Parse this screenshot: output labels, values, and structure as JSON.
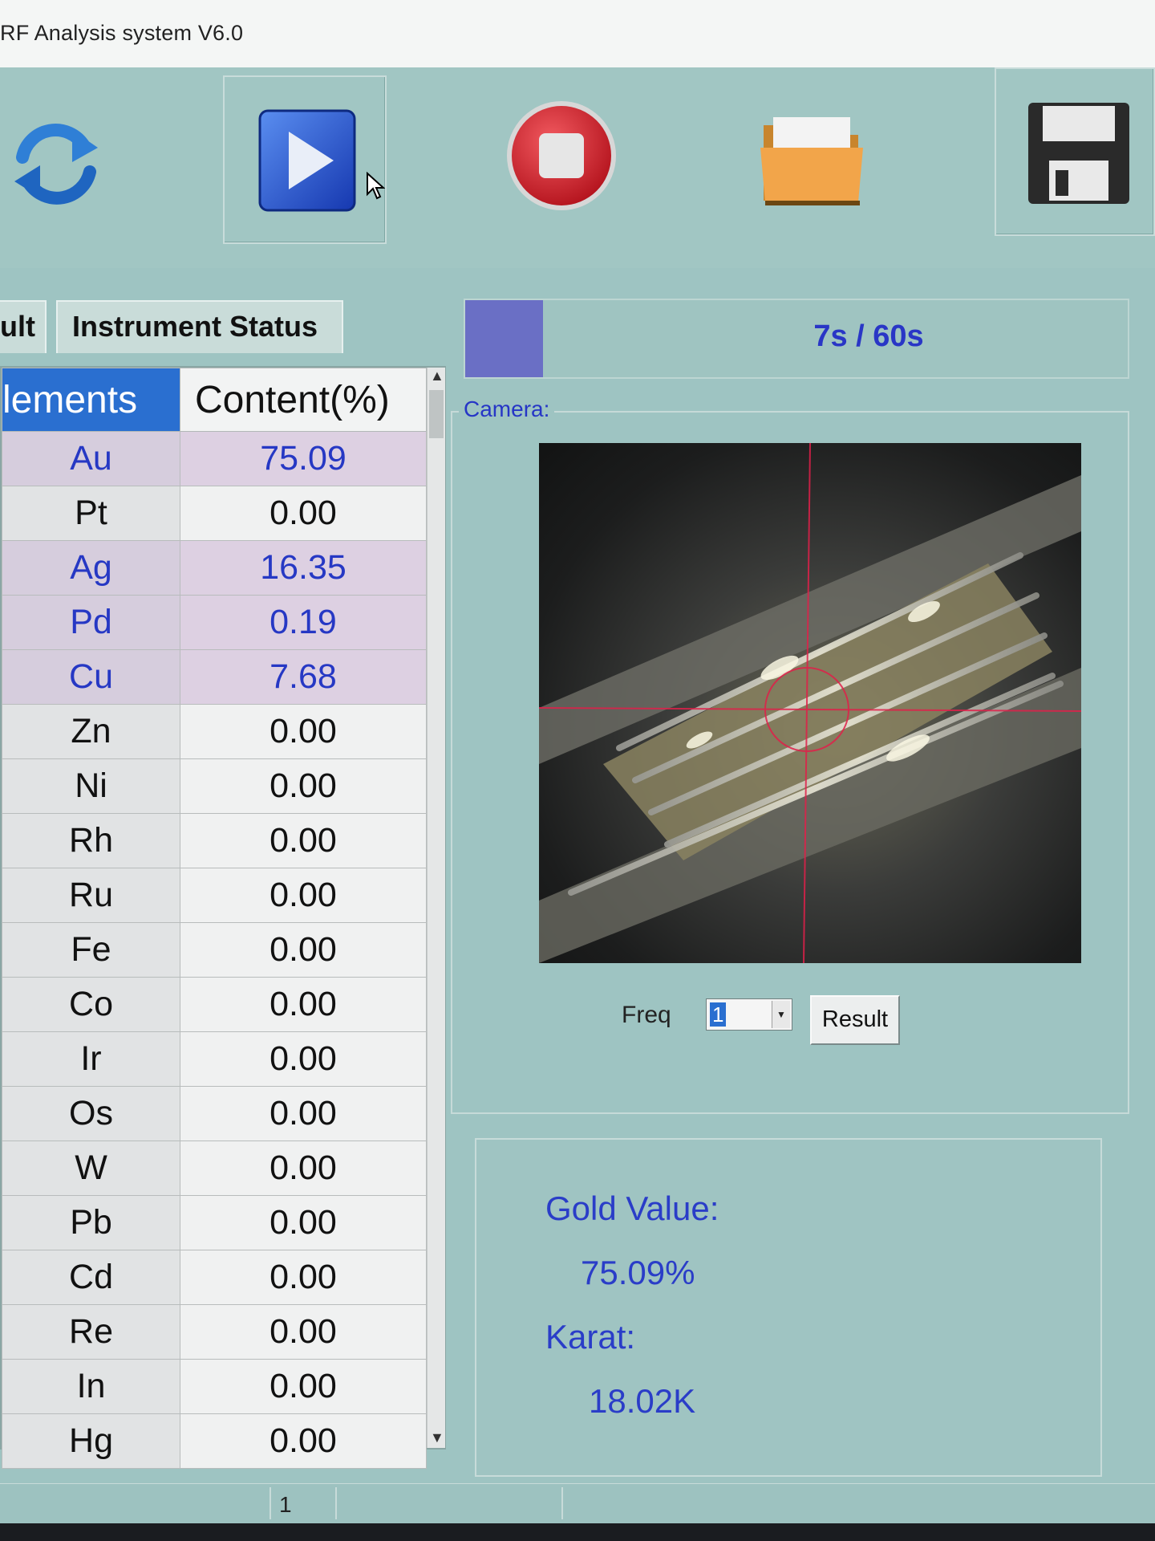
{
  "window": {
    "title": "RF Analysis system V6.0"
  },
  "toolbar": {
    "buttons": [
      {
        "name": "refresh-icon"
      },
      {
        "name": "play-icon"
      },
      {
        "name": "stop-icon"
      },
      {
        "name": "folder-icon"
      },
      {
        "name": "save-icon"
      }
    ]
  },
  "tabs": [
    {
      "label": "ult"
    },
    {
      "label": "Instrument Status"
    }
  ],
  "progress": {
    "text": "7s / 60s",
    "fraction": 0.117
  },
  "table": {
    "headers": {
      "element": "lements",
      "content": "Content(%)"
    },
    "rows": [
      {
        "el": "Au",
        "val": "75.09",
        "hi": true
      },
      {
        "el": "Pt",
        "val": "0.00",
        "hi": false
      },
      {
        "el": "Ag",
        "val": "16.35",
        "hi": true
      },
      {
        "el": "Pd",
        "val": "0.19",
        "hi": true
      },
      {
        "el": "Cu",
        "val": "7.68",
        "hi": true
      },
      {
        "el": "Zn",
        "val": "0.00",
        "hi": false
      },
      {
        "el": "Ni",
        "val": "0.00",
        "hi": false
      },
      {
        "el": "Rh",
        "val": "0.00",
        "hi": false
      },
      {
        "el": "Ru",
        "val": "0.00",
        "hi": false
      },
      {
        "el": "Fe",
        "val": "0.00",
        "hi": false
      },
      {
        "el": "Co",
        "val": "0.00",
        "hi": false
      },
      {
        "el": "Ir",
        "val": "0.00",
        "hi": false
      },
      {
        "el": "Os",
        "val": "0.00",
        "hi": false
      },
      {
        "el": "W",
        "val": "0.00",
        "hi": false
      },
      {
        "el": "Pb",
        "val": "0.00",
        "hi": false
      },
      {
        "el": "Cd",
        "val": "0.00",
        "hi": false
      },
      {
        "el": "Re",
        "val": "0.00",
        "hi": false
      },
      {
        "el": "In",
        "val": "0.00",
        "hi": false
      },
      {
        "el": "Hg",
        "val": "0.00",
        "hi": false
      }
    ]
  },
  "camera": {
    "label": "Camera:"
  },
  "controls": {
    "freq_label": "Freq",
    "freq_value": "1",
    "result_label": "Result"
  },
  "result": {
    "gold_label": "Gold Value:",
    "gold_value": "75.09%",
    "karat_label": "Karat:",
    "karat_value": "18.02K"
  },
  "statusbar": {
    "page": "1"
  },
  "colors": {
    "background": "#9ec4c2",
    "accent_text": "#2636c6",
    "header_blue": "#2a6fd0",
    "highlight_row": "#ddd0e2",
    "progress_fill": "#6a6fc5",
    "crosshair": "#e0204a"
  }
}
